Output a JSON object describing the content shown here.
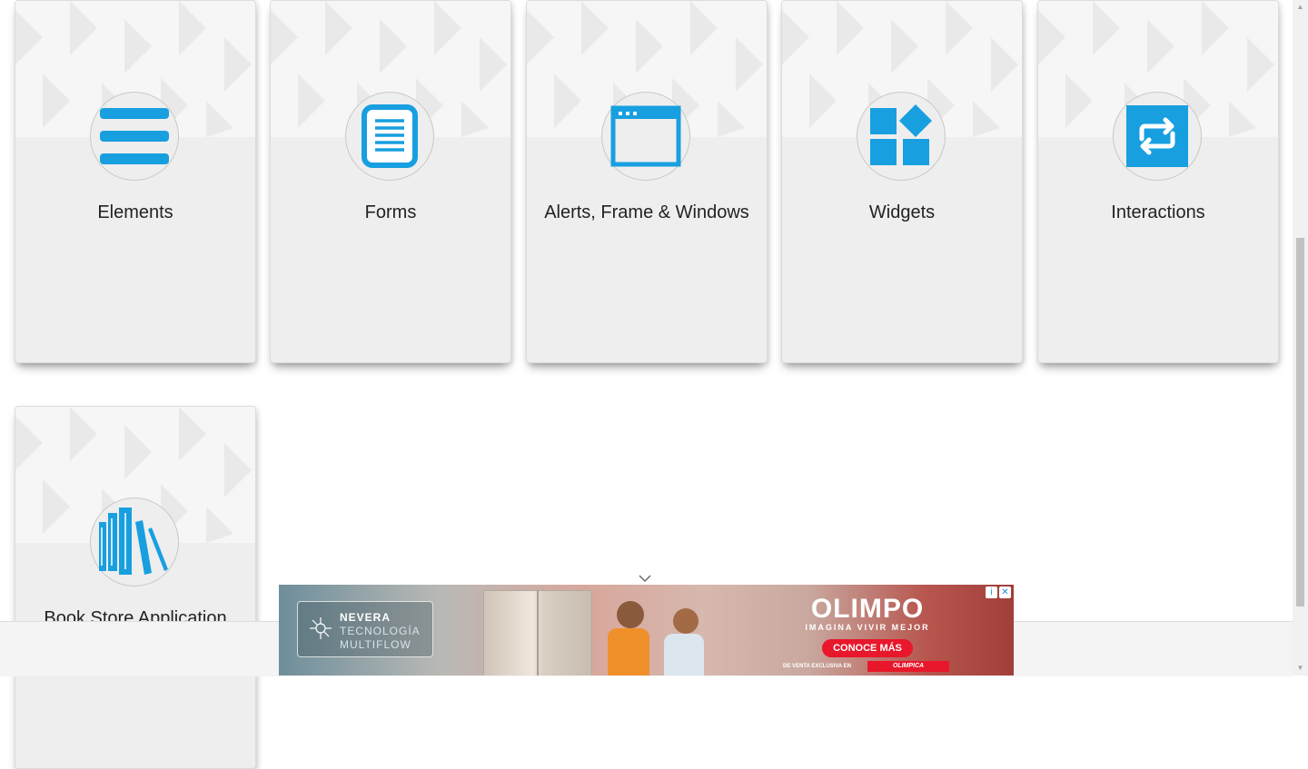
{
  "cards": [
    {
      "label": "Elements",
      "icon": "menu-lines-icon"
    },
    {
      "label": "Forms",
      "icon": "document-icon"
    },
    {
      "label": "Alerts, Frame & Windows",
      "icon": "browser-window-icon"
    },
    {
      "label": "Widgets",
      "icon": "widgets-icon"
    },
    {
      "label": "Interactions",
      "icon": "swap-arrows-icon"
    },
    {
      "label": "Book Store Application",
      "icon": "books-icon"
    }
  ],
  "ad": {
    "badge_line1": "NEVERA",
    "badge_line2": "TECNOLOGÍA",
    "badge_line3": "MULTIFLOW",
    "brand": "OLIMPO",
    "tagline": "IMAGINA VIVIR MEJOR",
    "cta": "CONOCE MÁS",
    "exclusive": "DE VENTA EXCLUSIVA EN",
    "retailer": "OLIMPICA"
  },
  "colors": {
    "accent": "#189fe0",
    "card_bg": "#eeeeee"
  }
}
